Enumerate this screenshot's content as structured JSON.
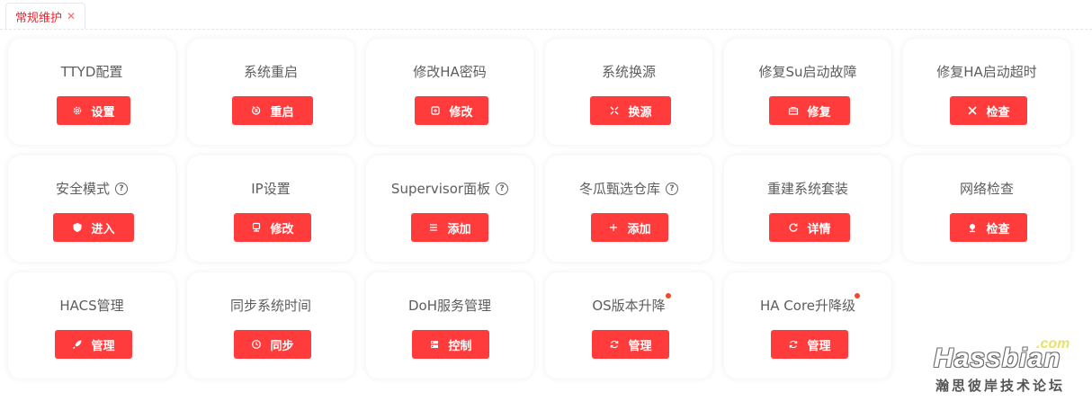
{
  "tab": {
    "label": "常规维护",
    "close": "✕"
  },
  "cards": [
    {
      "title": "TTYD配置",
      "button": "设置",
      "icon": "gear-icon"
    },
    {
      "title": "系统重启",
      "button": "重启",
      "icon": "restart-icon"
    },
    {
      "title": "修改HA密码",
      "button": "修改",
      "icon": "key-icon"
    },
    {
      "title": "系统换源",
      "button": "换源",
      "icon": "switch-icon"
    },
    {
      "title": "修复Su启动故障",
      "button": "修复",
      "icon": "toolbox-icon"
    },
    {
      "title": "修复HA启动超时",
      "button": "检查",
      "icon": "tools-icon"
    },
    {
      "title": "安全模式",
      "button": "进入",
      "icon": "shield-icon",
      "help": "?"
    },
    {
      "title": "IP设置",
      "button": "修改",
      "icon": "monitor-icon"
    },
    {
      "title": "Supervisor面板",
      "button": "添加",
      "icon": "menu-icon",
      "help": "?"
    },
    {
      "title": "冬瓜甄选仓库",
      "button": "添加",
      "icon": "plus-icon",
      "help": "?"
    },
    {
      "title": "重建系统套装",
      "button": "详情",
      "icon": "refresh-icon"
    },
    {
      "title": "网络检查",
      "button": "检查",
      "icon": "pin-icon"
    },
    {
      "title": "HACS管理",
      "button": "管理",
      "icon": "rocket-icon"
    },
    {
      "title": "同步系统时间",
      "button": "同步",
      "icon": "clock-icon"
    },
    {
      "title": "DoH服务管理",
      "button": "控制",
      "icon": "server-icon"
    },
    {
      "title": "OS版本升降",
      "button": "管理",
      "icon": "sync-icon",
      "dot": true
    },
    {
      "title": "HA Core升降级",
      "button": "管理",
      "icon": "sync-icon",
      "dot": true
    }
  ],
  "watermark": {
    "com": ".com",
    "brand": "Hassbian",
    "cn": "瀚思彼岸技术论坛"
  },
  "colors": {
    "accent": "#ff3b3b",
    "tab_text": "#f5222d",
    "dot": "#f5462d"
  }
}
